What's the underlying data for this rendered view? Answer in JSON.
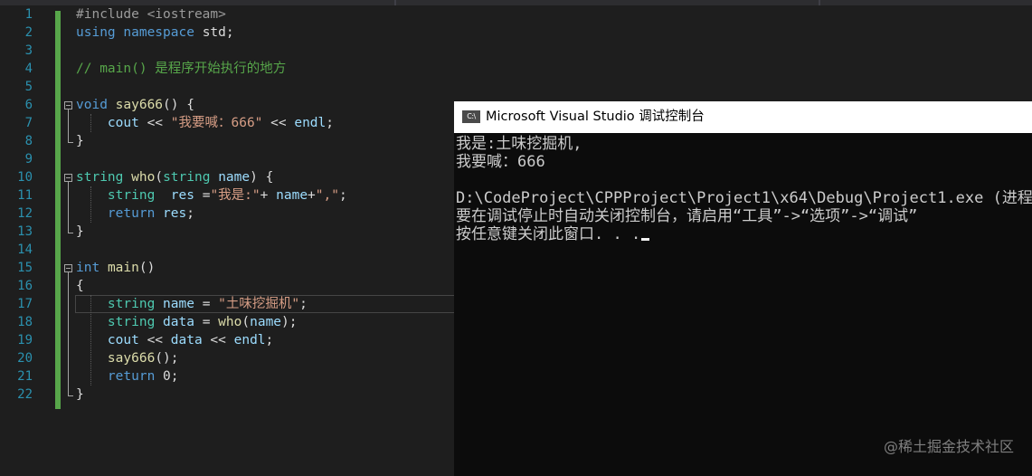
{
  "editor": {
    "line_numbers": [
      "1",
      "2",
      "3",
      "4",
      "5",
      "6",
      "7",
      "8",
      "9",
      "10",
      "11",
      "12",
      "13",
      "14",
      "15",
      "16",
      "17",
      "18",
      "19",
      "20",
      "21",
      "22"
    ],
    "lines": [
      [
        {
          "c": "pp",
          "t": "#include <iostream>"
        }
      ],
      [
        {
          "c": "kw",
          "t": "using"
        },
        {
          "c": "",
          "t": " "
        },
        {
          "c": "kw",
          "t": "namespace"
        },
        {
          "c": "",
          "t": " std;"
        }
      ],
      [],
      [
        {
          "c": "cm",
          "t": "// main() 是程序开始执行的地方"
        }
      ],
      [],
      [
        {
          "c": "kw",
          "t": "void"
        },
        {
          "c": "",
          "t": " "
        },
        {
          "c": "fn",
          "t": "say666"
        },
        {
          "c": "",
          "t": "() {"
        }
      ],
      [
        {
          "c": "",
          "t": "    "
        },
        {
          "c": "vr",
          "t": "cout"
        },
        {
          "c": "",
          "t": " << "
        },
        {
          "c": "st",
          "t": "\"我要喊：666\""
        },
        {
          "c": "",
          "t": " << "
        },
        {
          "c": "vr",
          "t": "endl"
        },
        {
          "c": "",
          "t": ";"
        }
      ],
      [
        {
          "c": "",
          "t": "}"
        }
      ],
      [],
      [
        {
          "c": "ty",
          "t": "string"
        },
        {
          "c": "",
          "t": " "
        },
        {
          "c": "fn",
          "t": "who"
        },
        {
          "c": "",
          "t": "("
        },
        {
          "c": "ty",
          "t": "string"
        },
        {
          "c": "",
          "t": " "
        },
        {
          "c": "vr",
          "t": "name"
        },
        {
          "c": "",
          "t": ") {"
        }
      ],
      [
        {
          "c": "",
          "t": "    "
        },
        {
          "c": "ty",
          "t": "string"
        },
        {
          "c": "",
          "t": "  "
        },
        {
          "c": "vr",
          "t": "res"
        },
        {
          "c": "",
          "t": " ="
        },
        {
          "c": "st",
          "t": "\"我是:\""
        },
        {
          "c": "",
          "t": "+ "
        },
        {
          "c": "vr",
          "t": "name"
        },
        {
          "c": "",
          "t": "+"
        },
        {
          "c": "st",
          "t": "\",\""
        },
        {
          "c": "",
          "t": ";"
        }
      ],
      [
        {
          "c": "",
          "t": "    "
        },
        {
          "c": "kw",
          "t": "return"
        },
        {
          "c": "",
          "t": " "
        },
        {
          "c": "vr",
          "t": "res"
        },
        {
          "c": "",
          "t": ";"
        }
      ],
      [
        {
          "c": "",
          "t": "}"
        }
      ],
      [],
      [
        {
          "c": "kw",
          "t": "int"
        },
        {
          "c": "",
          "t": " "
        },
        {
          "c": "fn",
          "t": "main"
        },
        {
          "c": "",
          "t": "()"
        }
      ],
      [
        {
          "c": "",
          "t": "{"
        }
      ],
      [
        {
          "c": "",
          "t": "    "
        },
        {
          "c": "ty",
          "t": "string"
        },
        {
          "c": "",
          "t": " "
        },
        {
          "c": "vr",
          "t": "name"
        },
        {
          "c": "",
          "t": " = "
        },
        {
          "c": "st",
          "t": "\"土味挖掘机\""
        },
        {
          "c": "",
          "t": ";"
        }
      ],
      [
        {
          "c": "",
          "t": "    "
        },
        {
          "c": "ty",
          "t": "string"
        },
        {
          "c": "",
          "t": " "
        },
        {
          "c": "vr",
          "t": "data"
        },
        {
          "c": "",
          "t": " = "
        },
        {
          "c": "fn",
          "t": "who"
        },
        {
          "c": "",
          "t": "("
        },
        {
          "c": "vr",
          "t": "name"
        },
        {
          "c": "",
          "t": ");"
        }
      ],
      [
        {
          "c": "",
          "t": "    "
        },
        {
          "c": "vr",
          "t": "cout"
        },
        {
          "c": "",
          "t": " << "
        },
        {
          "c": "vr",
          "t": "data"
        },
        {
          "c": "",
          "t": " << "
        },
        {
          "c": "vr",
          "t": "endl"
        },
        {
          "c": "",
          "t": ";"
        }
      ],
      [
        {
          "c": "",
          "t": "    "
        },
        {
          "c": "fn",
          "t": "say666"
        },
        {
          "c": "",
          "t": "();"
        }
      ],
      [
        {
          "c": "",
          "t": "    "
        },
        {
          "c": "kw",
          "t": "return"
        },
        {
          "c": "",
          "t": " 0;"
        }
      ],
      [
        {
          "c": "",
          "t": "}"
        }
      ]
    ]
  },
  "console": {
    "icon_text": "C:\\",
    "title": "Microsoft Visual Studio 调试控制台",
    "lines": [
      "我是:土味挖掘机,",
      "我要喊：666",
      "",
      "D:\\CodeProject\\CPPProject\\Project1\\x64\\Debug\\Project1.exe (进程",
      "要在调试停止时自动关闭控制台，请启用“工具”->“选项”->“调试”",
      "按任意键关闭此窗口. . ."
    ]
  },
  "watermark": "@稀土掘金技术社区"
}
